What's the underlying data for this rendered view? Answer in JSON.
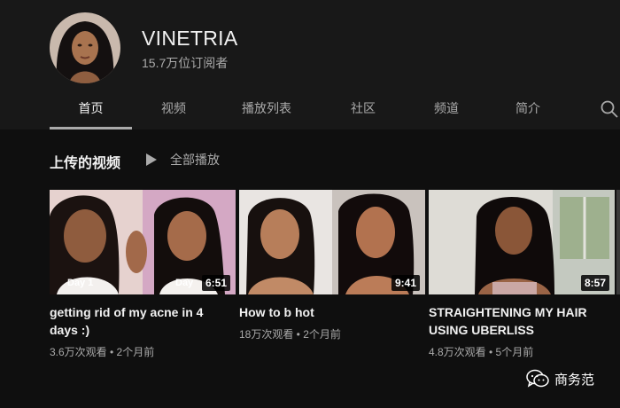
{
  "channel": {
    "name": "VINETRIA",
    "subscribers": "15.7万位订阅者"
  },
  "tabs": [
    {
      "label": "首页",
      "active": true
    },
    {
      "label": "视频",
      "active": false
    },
    {
      "label": "播放列表",
      "active": false
    },
    {
      "label": "社区",
      "active": false
    },
    {
      "label": "频道",
      "active": false
    },
    {
      "label": "简介",
      "active": false
    }
  ],
  "section": {
    "title": "上传的视频",
    "play_all": "全部播放"
  },
  "videos": [
    {
      "title": "getting rid of my acne in 4 days :)",
      "meta": "3.6万次观看 • 2个月前",
      "duration": "6:51",
      "thumb_label_left": "Day 1",
      "thumb_label_right": "Day"
    },
    {
      "title": "How to b hot",
      "meta": "18万次观看 • 2个月前",
      "duration": "9:41"
    },
    {
      "title": "STRAIGHTENING MY HAIR USING UBERLISS",
      "meta": "4.8万次观看 • 5个月前",
      "duration": "8:57"
    }
  ],
  "watermark": {
    "text": "商务范",
    "icon": "wechat-icon"
  },
  "icons": {
    "search": "search-icon",
    "play": "play-icon"
  }
}
